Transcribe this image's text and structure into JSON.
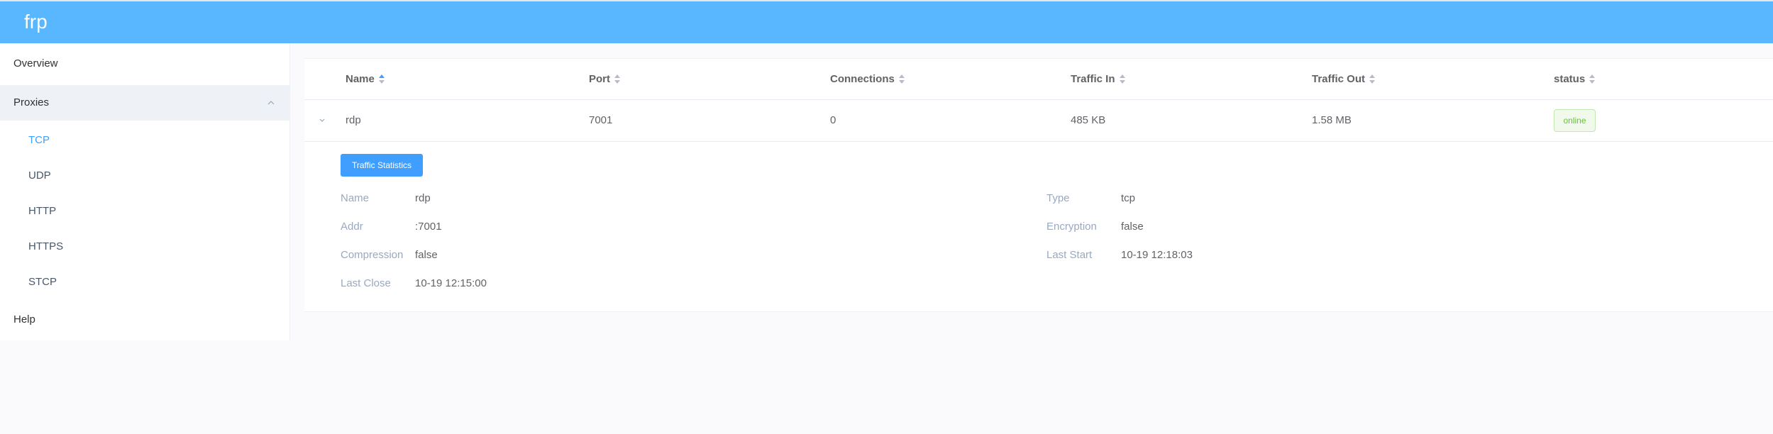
{
  "app": {
    "title": "frp"
  },
  "sidebar": {
    "overview": "Overview",
    "proxies": "Proxies",
    "proxy_types": [
      "TCP",
      "UDP",
      "HTTP",
      "HTTPS",
      "STCP"
    ],
    "help": "Help"
  },
  "table": {
    "columns": [
      "Name",
      "Port",
      "Connections",
      "Traffic In",
      "Traffic Out",
      "status"
    ],
    "rows": [
      {
        "name": "rdp",
        "port": "7001",
        "connections": "0",
        "traffic_in": "485 KB",
        "traffic_out": "1.58 MB",
        "status": "online"
      }
    ]
  },
  "details": {
    "button_label": "Traffic Statistics",
    "name_label": "Name",
    "name_value": "rdp",
    "addr_label": "Addr",
    "addr_value": ":7001",
    "compression_label": "Compression",
    "compression_value": "false",
    "last_close_label": "Last Close",
    "last_close_value": "10-19 12:15:00",
    "type_label": "Type",
    "type_value": "tcp",
    "encryption_label": "Encryption",
    "encryption_value": "false",
    "last_start_label": "Last Start",
    "last_start_value": "10-19 12:18:03"
  },
  "colors": {
    "header": "#58b7ff",
    "accent": "#409eff",
    "status_online": "#67c23a"
  },
  "icons": [
    "chevron-up-icon",
    "chevron-down-icon",
    "sort-icon"
  ]
}
